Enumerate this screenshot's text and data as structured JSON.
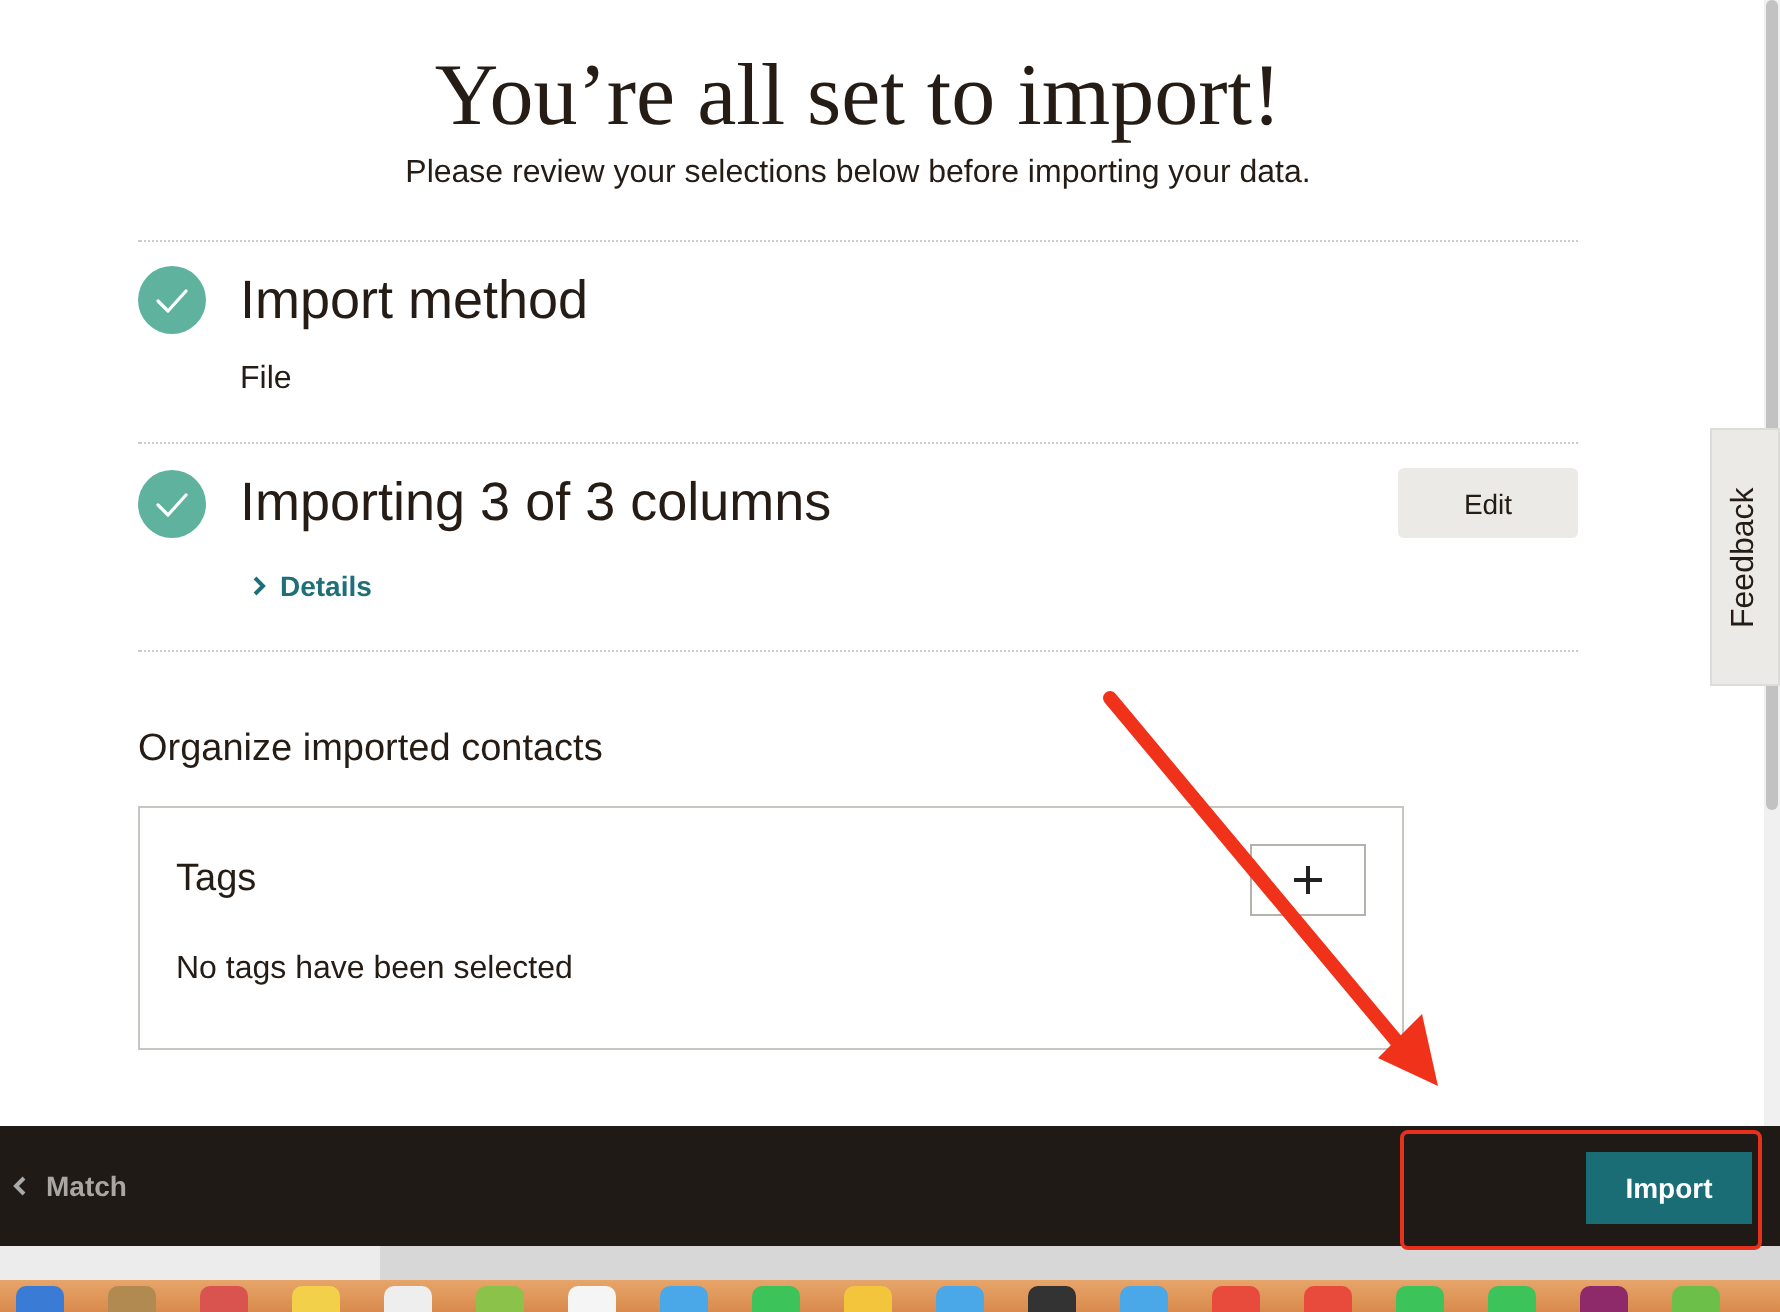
{
  "page": {
    "title": "You’re all set to import!",
    "subtitle": "Please review your selections below before importing your data.",
    "sections": [
      {
        "heading": "Import method",
        "done": true,
        "detail": "File"
      },
      {
        "heading": "Importing 3 of 3 columns",
        "done": true,
        "edit_button": "Edit",
        "details_link": "Details"
      }
    ],
    "organize": {
      "heading": "Organize imported contacts",
      "tags": {
        "label": "Tags",
        "empty_text": "No tags have been selected"
      }
    }
  },
  "feedback_tab": "Feedback",
  "footer": {
    "back_link": "Match",
    "import_button": "Import"
  }
}
